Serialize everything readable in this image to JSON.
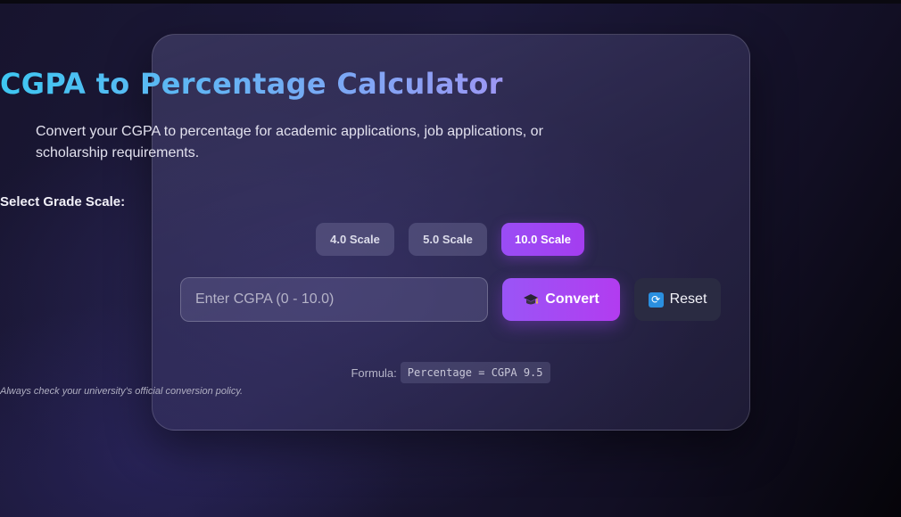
{
  "calculator": {
    "title": "CGPA to Percentage Calculator",
    "subtitle_line1": "Convert your CGPA to percentage for academic applications, job applications, or",
    "subtitle_line2": "scholarship requirements.",
    "scale_label": "Select Grade Scale:",
    "scales": [
      {
        "label": "4.0 Scale",
        "active": false
      },
      {
        "label": "5.0 Scale",
        "active": false
      },
      {
        "label": "10.0 Scale",
        "active": true
      }
    ],
    "input": {
      "placeholder": "Enter CGPA (0 - 10.0)",
      "value": ""
    },
    "convert_label": "Convert",
    "convert_icon": "graduation-cap-icon",
    "reset_label": "Reset",
    "reset_icon": "refresh-icon",
    "formula_prefix": "Formula:",
    "formula": "Percentage = CGPA 9.5",
    "note": "Always check your university's official conversion policy."
  },
  "colors": {
    "accent": "#a43df0",
    "title_gradient": [
      "#3ec7f2",
      "#b88af2",
      "#d76bee"
    ],
    "reset_bg": "#2a2b42",
    "reset_icon_bg": "#2a8fe0"
  }
}
